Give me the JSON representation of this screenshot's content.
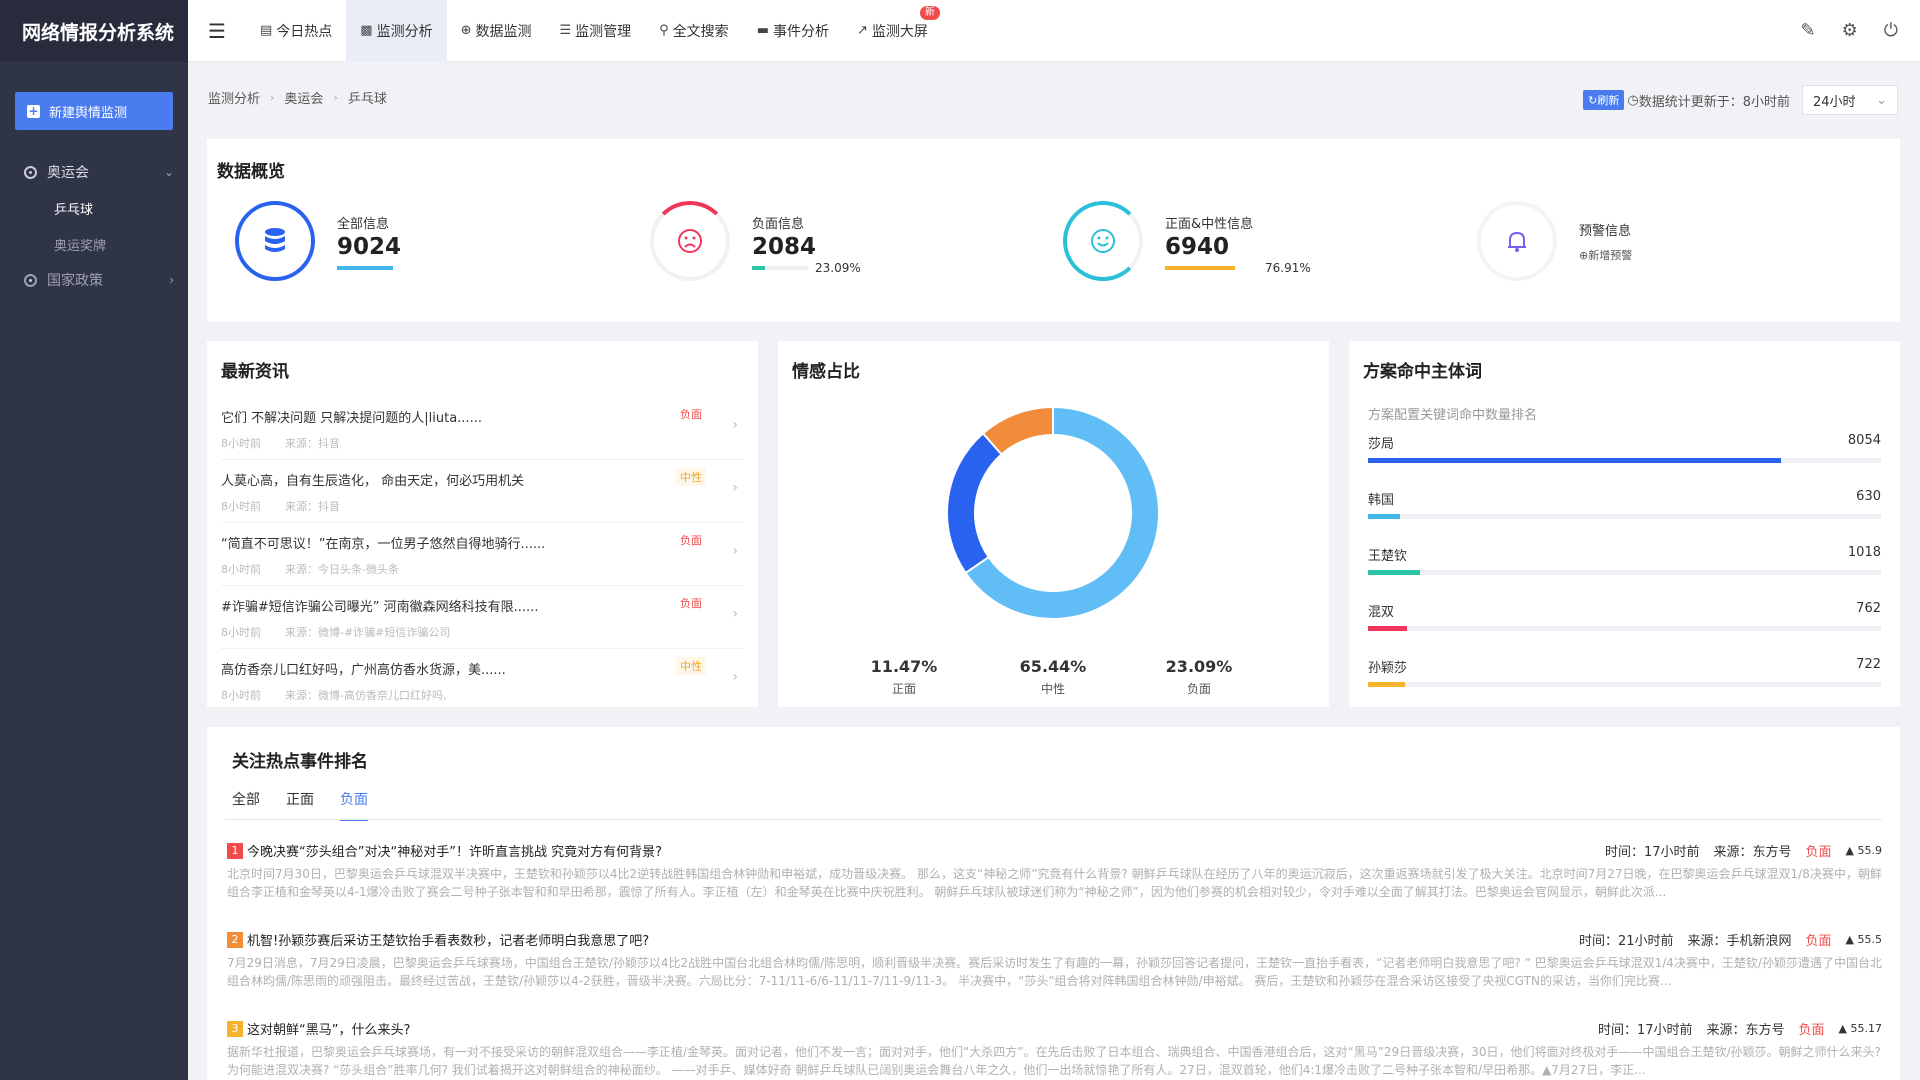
{
  "app": {
    "title": "网络情报分析系统"
  },
  "sidebar": {
    "new_button": "新建舆情监测",
    "groups": [
      {
        "label": "奥运会",
        "children": [
          "乒乓球",
          "奥运奖牌"
        ]
      },
      {
        "label": "国家政策"
      }
    ]
  },
  "nav": {
    "items": [
      "今日热点",
      "监测分析",
      "数据监测",
      "监测管理",
      "全文搜索",
      "事件分析",
      "监测大屏"
    ],
    "active": "监测分析",
    "new_badge": "新"
  },
  "breadcrumb": [
    "监测分析",
    "奥运会",
    "乒乓球"
  ],
  "refresh": {
    "button": "刷新",
    "text": "数据统计更新于：8小时前",
    "range": "24小时"
  },
  "overview": {
    "title": "数据概览",
    "all": {
      "label": "全部信息",
      "value": "9024"
    },
    "negative": {
      "label": "负面信息",
      "value": "2084",
      "pct": "23.09%"
    },
    "positive": {
      "label": "正面&中性信息",
      "value": "6940",
      "pct": "76.91%"
    },
    "warning": {
      "label": "预警信息",
      "action": "新增预警"
    }
  },
  "news": {
    "title": "最新资讯",
    "items": [
      {
        "title": "它们 不解决问题 只解决提问题的人|liuta......",
        "time": "8小时前",
        "source": "来源：抖音",
        "tag": "负面"
      },
      {
        "title": "人莫心高，自有生辰造化， 命由天定，何必巧用机关",
        "time": "8小时前",
        "source": "来源：抖音",
        "tag": "中性"
      },
      {
        "title": "“简直不可思议！”在南京，一位男子悠然自得地骑行......",
        "time": "8小时前",
        "source": "来源：今日头条-微头条",
        "tag": "负面"
      },
      {
        "title": "#诈骗#短信诈骗公司曝光” 河南徽森网络科技有限......",
        "time": "8小时前",
        "source": "来源：微博-#诈骗#短信诈骗公司",
        "tag": "负面"
      },
      {
        "title": "高仿香奈儿口红好吗，广州高仿香水货源，美......",
        "time": "8小时前",
        "source": "来源：微博-高仿香奈儿口红好吗,",
        "tag": "中性"
      }
    ]
  },
  "sentiment": {
    "title": "情感占比",
    "legend": [
      {
        "value": "11.47%",
        "name": "正面"
      },
      {
        "value": "65.44%",
        "name": "中性"
      },
      {
        "value": "23.09%",
        "name": "负面"
      }
    ]
  },
  "chart_data": {
    "type": "pie",
    "categories": [
      "中性",
      "负面",
      "正面"
    ],
    "values": [
      65.44,
      23.09,
      11.47
    ],
    "colors": [
      "#60bdf5",
      "#2a62f0",
      "#f08c3a"
    ]
  },
  "keywords": {
    "title": "方案命中主体词",
    "subtitle": "方案配置关键词命中数量排名",
    "max": 10000,
    "items": [
      {
        "name": "莎局",
        "count": "8054",
        "value": 8054,
        "color": "#2a62f0"
      },
      {
        "name": "韩国",
        "count": "630",
        "value": 630,
        "color": "#43b8e8"
      },
      {
        "name": "王楚钦",
        "count": "1018",
        "value": 1018,
        "color": "#2dc5a7"
      },
      {
        "name": "混双",
        "count": "762",
        "value": 762,
        "color": "#f0365a"
      },
      {
        "name": "孙颖莎",
        "count": "722",
        "value": 722,
        "color": "#f5b22a"
      }
    ]
  },
  "hot": {
    "title": "关注热点事件排名",
    "tabs": [
      "全部",
      "正面",
      "负面"
    ],
    "active_tab": "负面",
    "events": [
      {
        "rank": "1",
        "color": "#f04b4b",
        "title": "今晚决赛“莎头组合”对决“神秘对手”！许昕直言挑战 究竟对方有何背景?",
        "time": "时间：17小时前",
        "source": "来源：东方号",
        "tag": "负面",
        "score": "55.9",
        "summary": "北京时间7月30日，巴黎奥运会乒乓球混双半决赛中，王楚钦和孙颖莎以4比2逆转战胜韩国组合林钟勋和申裕斌，成功晋级决赛。 那么，这支“神秘之师”究竟有什么背景? 朝鲜乒乓球队在经历了八年的奥运沉寂后，这次重返赛场就引发了极大关注。北京时间7月27日晚，在巴黎奥运会乒乓球混双1/8决赛中，朝鲜组合李正植和金琴英以4-1爆冷击败了赛会二号种子张本智和和早田希那，震惊了所有人。李正植（左）和金琴英在比赛中庆祝胜利。 朝鲜乒乓球队被球迷们称为“神秘之师”，因为他们参赛的机会相对较少，令对手难以全面了解其打法。巴黎奥运会官网显示，朝鲜此次派..."
      },
      {
        "rank": "2",
        "color": "#f08c3a",
        "title": "机智!孙颖莎赛后采访王楚钦抬手看表数秒，记者老师明白我意思了吧?",
        "time": "时间：21小时前",
        "source": "来源：手机新浪网",
        "tag": "负面",
        "score": "55.5",
        "summary": "7月29日消息，7月29日凌晨，巴黎奥运会乒乓球赛场，中国组合王楚钦/孙颖莎以4比2战胜中国台北组合林昀儒/陈思明，顺利晋级半决赛。赛后采访时发生了有趣的一幕，孙颖莎回答记者提问，王楚钦一直抬手看表，“记者老师明白我意思了吧? ” 巴黎奥运会乒乓球混双1/4决赛中，王楚钦/孙颖莎遭遇了中国台北组合林昀儒/陈思雨的顽强阻击。最终经过苦战，王楚钦/孙颖莎以4-2获胜，晋级半决赛。六局比分：7-11/11-6/6-11/11-7/11-9/11-3。 半决赛中，“莎头”组合将对阵韩国组合林钟勋/申裕斌。 赛后，王楚钦和孙颖莎在混合采访区接受了央视CGTN的采访，当你们完比赛..."
      },
      {
        "rank": "3",
        "color": "#f5b22a",
        "title": "这对朝鲜“黑马”，什么来头?",
        "time": "时间：17小时前",
        "source": "来源：东方号",
        "tag": "负面",
        "score": "55.17",
        "summary": "据新华社报道，巴黎奥运会乒乓球赛场，有一对不接受采访的朝鲜混双组合——李正植/金琴英。面对记者，他们不发一言；面对对手，他们“大杀四方”。在先后击败了日本组合、瑞典组合、中国香港组合后，这对“黑马”29日晋级决赛，30日，他们将面对终极对手——中国组合王楚钦/孙颖莎。朝鲜之师什么来头? 为何能进混双决赛? “莎头组合”胜率几何? 我们试着揭开这对朝鲜组合的神秘面纱。 ——对手乒、媒体好奇 朝鲜乒乓球队已阔别奥运会舞台八年之久，他们一出场就惊艳了所有人。27日，混双首轮，他们4:1爆冷击败了二号种子张本智和/早田希那。▲7月27日，李正..."
      }
    ]
  }
}
